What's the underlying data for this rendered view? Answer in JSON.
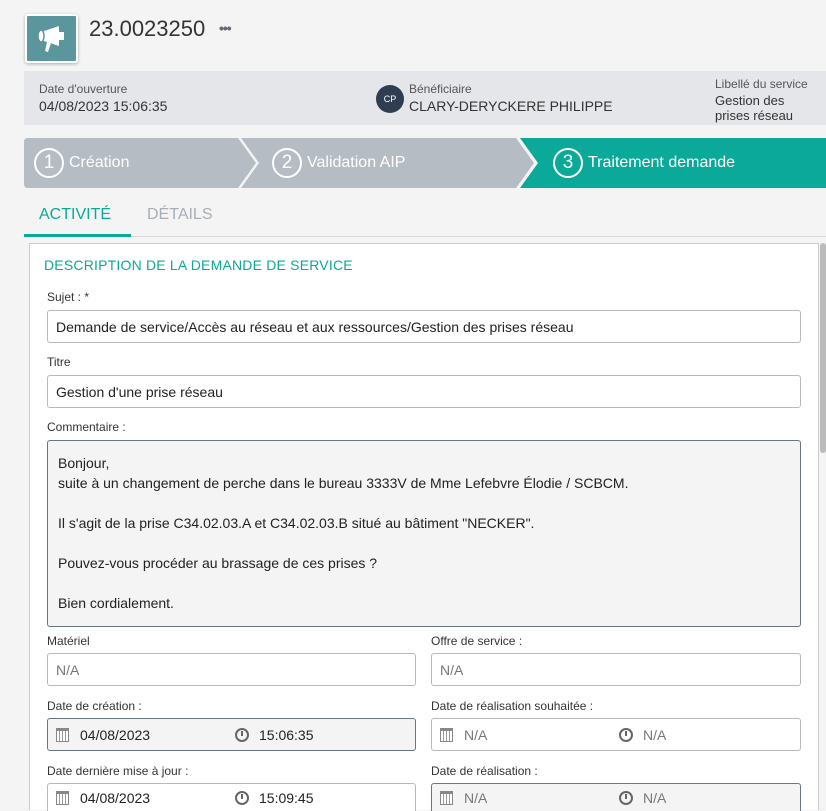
{
  "header": {
    "icon": "megaphone-icon",
    "title": "23.0023250",
    "more_label": "•••"
  },
  "info": {
    "opening_label": "Date d'ouverture",
    "opening_value": "04/08/2023 15:06:35",
    "beneficiary_initials": "CP",
    "beneficiary_label": "Bénéficiaire",
    "beneficiary_value": "CLARY-DERYCKERE PHILIPPE",
    "service_label": "Libellé du service",
    "service_value": "Gestion des prises réseau"
  },
  "steps": [
    {
      "num": "1",
      "label": "Création"
    },
    {
      "num": "2",
      "label": "Validation AIP"
    },
    {
      "num": "3",
      "label": "Traitement demande"
    }
  ],
  "colors": {
    "accent": "#0aa99a",
    "step_inactive": "#b6bcc4"
  },
  "tabs": [
    {
      "label": "ACTIVITÉ",
      "active": true
    },
    {
      "label": "DÉTAILS",
      "active": false
    }
  ],
  "form": {
    "section_title": "DESCRIPTION DE LA DEMANDE DE SERVICE",
    "subject_label": "Sujet : *",
    "subject_value": "Demande de service/Accès au réseau et aux ressources/Gestion des prises réseau",
    "title_label": "Titre",
    "title_value": "Gestion d'une prise réseau",
    "comment_label": "Commentaire :",
    "comment_lines": [
      "Bonjour,",
      "suite à un changement de perche dans le bureau 3333V de Mme Lefebvre Élodie / SCBCM.",
      "Il s'agit de la prise C34.02.03.A et C34.02.03.B situé au bâtiment \"NECKER\".",
      "Pouvez-vous procéder au brassage de ces prises ?",
      "Bien cordialement."
    ],
    "material_label": "Matériel",
    "material_value": "N/A",
    "offer_label": "Offre de service :",
    "offer_value": "N/A",
    "created_label": "Date de création :",
    "created_date": "04/08/2023",
    "created_time": "15:06:35",
    "wished_label": "Date de réalisation souhaitée :",
    "wished_date": "N/A",
    "wished_time": "N/A",
    "updated_label": "Date dernière mise à jour :",
    "updated_date": "04/08/2023",
    "updated_time": "15:09:45",
    "done_label": "Date de réalisation :",
    "done_date": "N/A",
    "done_time": "N/A"
  }
}
